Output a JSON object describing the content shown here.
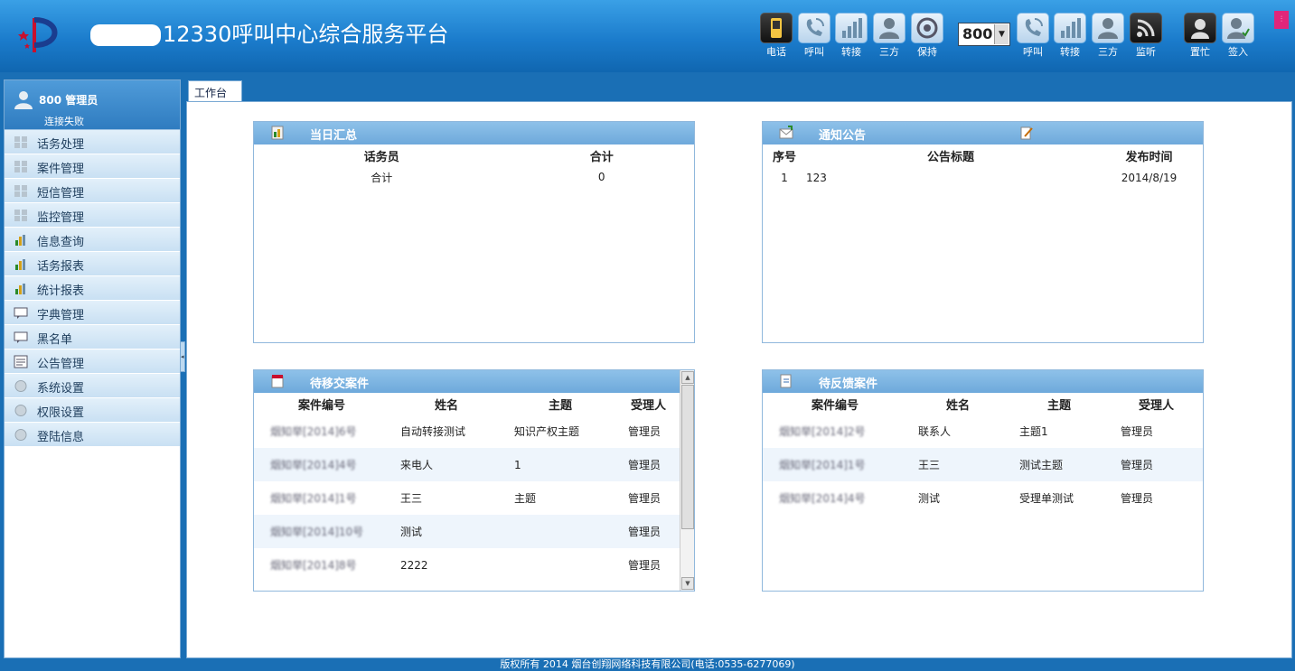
{
  "header": {
    "title": "12330呼叫中心综合服务平台",
    "toolbar_left": [
      {
        "label": "电话",
        "icon": "phone-icon"
      },
      {
        "label": "呼叫",
        "icon": "call-icon"
      },
      {
        "label": "转接",
        "icon": "transfer-icon"
      },
      {
        "label": "三方",
        "icon": "conference-icon"
      },
      {
        "label": "保持",
        "icon": "hold-icon"
      }
    ],
    "line_select": {
      "value": "800"
    },
    "toolbar_right": [
      {
        "label": "呼叫",
        "icon": "call-icon"
      },
      {
        "label": "转接",
        "icon": "transfer-icon"
      },
      {
        "label": "三方",
        "icon": "conference-icon"
      },
      {
        "label": "监听",
        "icon": "monitor-icon"
      }
    ],
    "toolbar_status": [
      {
        "label": "置忙",
        "icon": "busy-icon"
      },
      {
        "label": "签入",
        "icon": "sign-in-icon"
      }
    ]
  },
  "sidebar": {
    "user": {
      "name": "800 管理员",
      "status": "连接失败"
    },
    "items": [
      {
        "label": "话务处理",
        "icon": "grid-icon"
      },
      {
        "label": "案件管理",
        "icon": "grid-icon"
      },
      {
        "label": "短信管理",
        "icon": "grid-icon"
      },
      {
        "label": "监控管理",
        "icon": "grid-icon"
      },
      {
        "label": "信息查询",
        "icon": "bar-chart-icon"
      },
      {
        "label": "话务报表",
        "icon": "bar-chart-icon"
      },
      {
        "label": "统计报表",
        "icon": "bar-chart-icon"
      },
      {
        "label": "字典管理",
        "icon": "message-icon"
      },
      {
        "label": "黑名单",
        "icon": "message-icon"
      },
      {
        "label": "公告管理",
        "icon": "document-icon"
      },
      {
        "label": "系统设置",
        "icon": "circle-icon"
      },
      {
        "label": "权限设置",
        "icon": "circle-icon"
      },
      {
        "label": "登陆信息",
        "icon": "circle-icon"
      }
    ]
  },
  "tabs": [
    {
      "label": "工作台"
    }
  ],
  "daily_summary": {
    "title": "当日汇总",
    "headers": [
      "话务员",
      "合计"
    ],
    "rows": [
      [
        "合计",
        "0"
      ]
    ]
  },
  "notices": {
    "title": "通知公告",
    "headers": [
      "序号",
      "公告标题",
      "发布时间"
    ],
    "rows": [
      [
        "1",
        "123",
        "2014/8/19"
      ]
    ]
  },
  "pending_transfer": {
    "title": "待移交案件",
    "headers": [
      "案件编号",
      "姓名",
      "主题",
      "受理人"
    ],
    "rows": [
      [
        "烟知举[2014]6号",
        "自动转接测试",
        "知识产权主题",
        "管理员"
      ],
      [
        "烟知举[2014]4号",
        "来电人",
        "1",
        "管理员"
      ],
      [
        "烟知举[2014]1号",
        "王三",
        "主题",
        "管理员"
      ],
      [
        "烟知举[2014]10号",
        "测试",
        "",
        "管理员"
      ],
      [
        "烟知举[2014]8号",
        "2222",
        "",
        "管理员"
      ]
    ]
  },
  "pending_feedback": {
    "title": "待反馈案件",
    "headers": [
      "案件编号",
      "姓名",
      "主题",
      "受理人"
    ],
    "rows": [
      [
        "烟知举[2014]2号",
        "联系人",
        "主题1",
        "管理员"
      ],
      [
        "烟知举[2014]1号",
        "王三",
        "测试主题",
        "管理员"
      ],
      [
        "烟知举[2014]4号",
        "测试",
        "受理单测试",
        "管理员"
      ]
    ]
  },
  "footer": {
    "text": "版权所有 2014 烟台创翔网络科技有限公司(电话:0535-6277069)"
  }
}
